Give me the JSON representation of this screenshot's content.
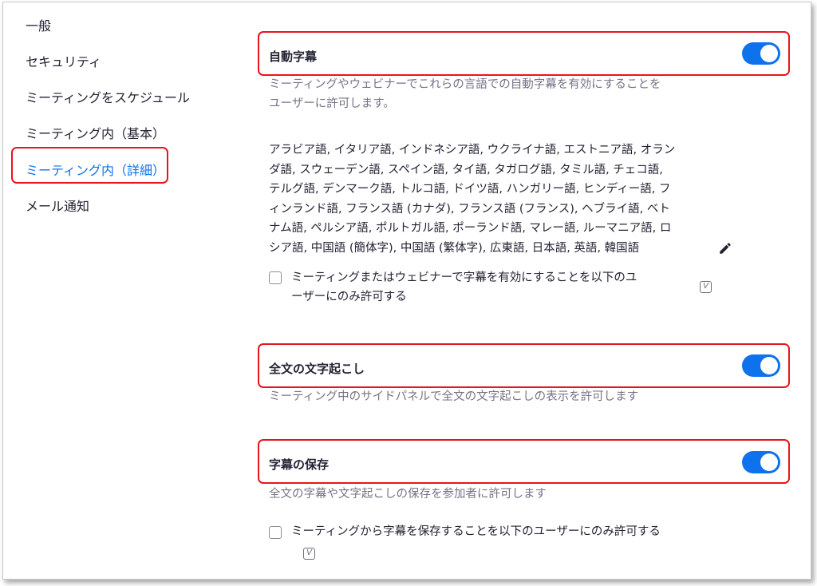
{
  "sidebar": {
    "items": [
      {
        "label": "一般"
      },
      {
        "label": "セキュリティ"
      },
      {
        "label": "ミーティングをスケジュール"
      },
      {
        "label": "ミーティング内（基本）"
      },
      {
        "label": "ミーティング内（詳細）",
        "active": true
      },
      {
        "label": "メール通知"
      }
    ]
  },
  "auto_caption": {
    "title": "自動字幕",
    "enabled": true,
    "desc_line1": "ミーティングやウェビナーでこれらの言語での自動字幕を有効にすることを",
    "desc_line2": "ユーザーに許可します。",
    "languages_lines": [
      "アラビア語, イタリア語, インドネシア語, ウクライナ語, エストニア語, オラン",
      "ダ語, スウェーデン語, スペイン語, タイ語, タガログ語, タミル語, チェコ語,",
      "テルグ語, デンマーク語, トルコ語, ドイツ語, ハンガリー語, ヒンディー語, フ",
      "ィンランド語, フランス語 (カナダ), フランス語 (フランス), ヘブライ語, ベト",
      "ナム語, ペルシア語, ポルトガル語, ポーランド語, マレー語, ルーマニア語, ロ",
      "シア語, 中国語 (簡体字), 中国語 (繁体字), 広東語, 日本語, 英語, 韓国語"
    ],
    "edit_icon": "pencil-icon",
    "restrict_label_line1": "ミーティングまたはウェビナーで字幕を有効にすることを以下のユ",
    "restrict_label_line2": "ーザーにのみ許可する",
    "restrict_checked": false,
    "badge": "V"
  },
  "full_transcript": {
    "title": "全文の文字起こし",
    "enabled": true,
    "desc": "ミーティング中のサイドパネルで全文の文字起こしの表示を許可します"
  },
  "save_captions": {
    "title": "字幕の保存",
    "enabled": true,
    "desc": "全文の字幕や文字起こしの保存を参加者に許可します",
    "restrict_label": "ミーティングから字幕を保存することを以下のユーザーにのみ許可する",
    "restrict_checked": false,
    "badge": "V"
  },
  "colors": {
    "accent": "#0e72ed",
    "highlight": "#e8141e"
  }
}
